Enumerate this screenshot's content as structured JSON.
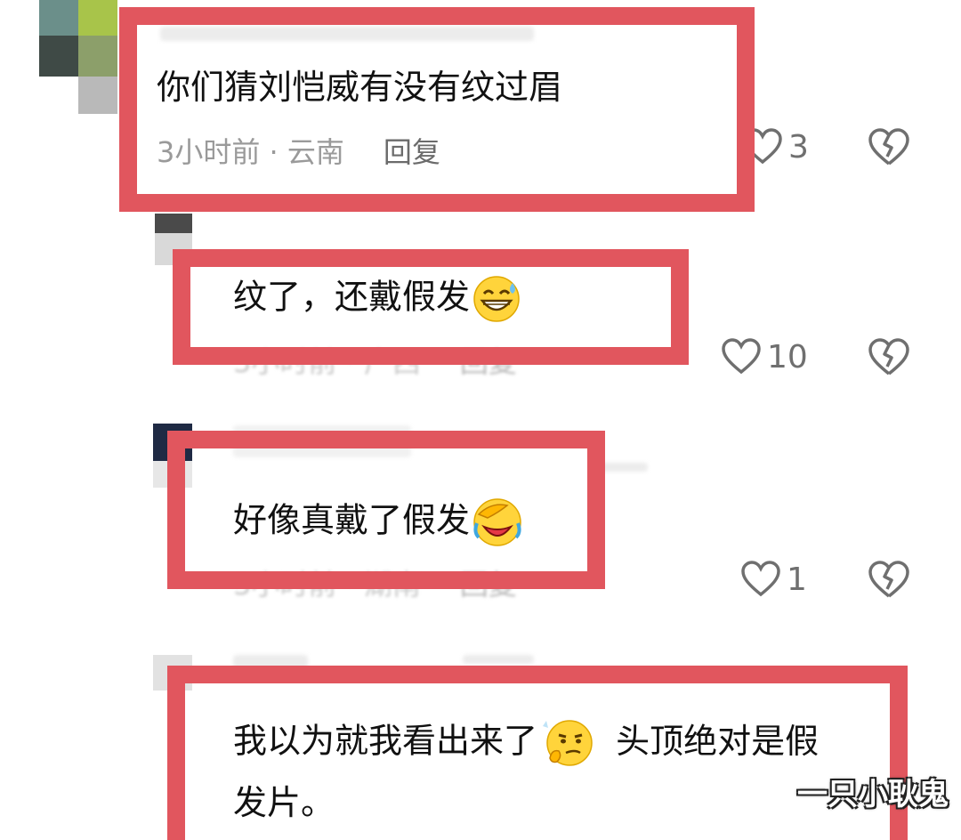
{
  "comments": [
    {
      "text": "你们猜刘恺威有没有纹过眉",
      "meta": "3小时前 · 云南",
      "reply_label": "回复",
      "likes": "3"
    },
    {
      "text": "纹了，还戴假发",
      "emoji": "grinning-sweat-emoji",
      "meta": "3小时前 · 广西",
      "reply_label": "回复",
      "likes": "10"
    },
    {
      "text": "好像真戴了假发",
      "emoji": "facepalm-laugh-emoji",
      "meta": "3小时前 · 湖南",
      "reply_label": "回复",
      "likes": "1"
    },
    {
      "text_line1": "我以为就我看出来了",
      "emoji": "thinking-smirk-emoji",
      "text_line1b": "头顶绝对是假",
      "text_line2": "发片。"
    }
  ],
  "watermark": "一只小耿鬼",
  "colors": {
    "highlight_box": "#e1565e",
    "meta_text": "#9a9a9a",
    "like_icon": "#6f6f6f"
  }
}
